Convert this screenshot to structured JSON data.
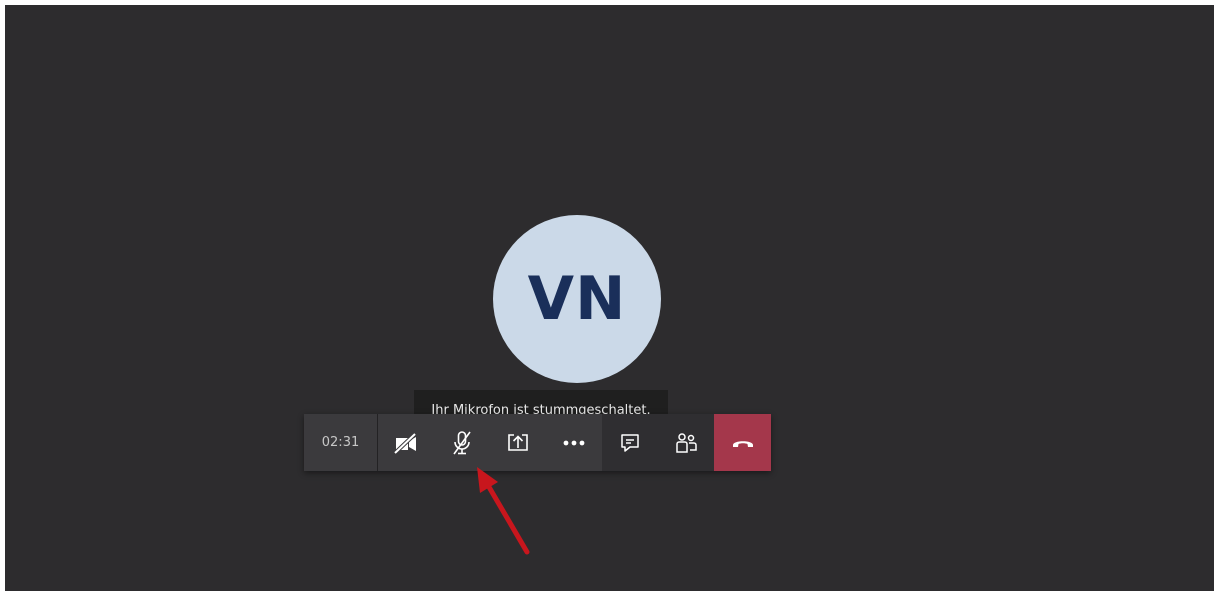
{
  "call": {
    "avatar_initials": "VN",
    "tooltip_text": "Ihr Mikrofon ist stummgeschaltet.",
    "timer": "02:31"
  },
  "toolbar": {
    "buttons": [
      {
        "name": "camera-off",
        "icon": "camera-off-icon"
      },
      {
        "name": "microphone-muted",
        "icon": "microphone-off-icon"
      },
      {
        "name": "share-screen",
        "icon": "share-screen-icon"
      },
      {
        "name": "more-options",
        "icon": "more-icon"
      },
      {
        "name": "chat",
        "icon": "chat-icon"
      },
      {
        "name": "participants",
        "icon": "participants-icon"
      },
      {
        "name": "hang-up",
        "icon": "hang-up-icon"
      }
    ]
  },
  "colors": {
    "background": "#2d2c2e",
    "avatar_bg": "#cbd9e8",
    "avatar_text": "#1a2f5a",
    "hangup": "#a4374b",
    "annotation_arrow": "#c8161d"
  }
}
